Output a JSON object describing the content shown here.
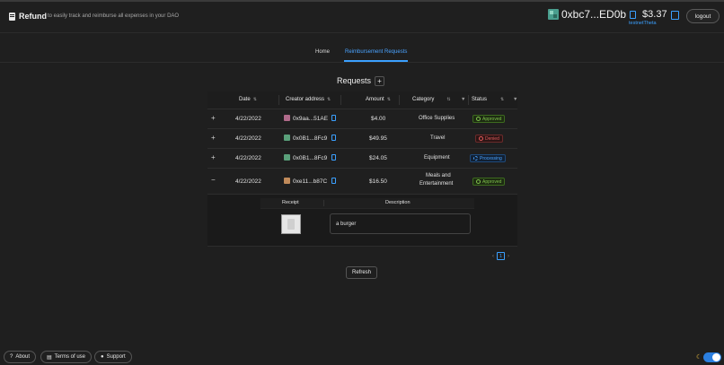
{
  "header": {
    "app_name": "Refund",
    "tagline": "to easily track and reimburse all expenses in your DAO",
    "wallet_address": "0xbc7...ED0b",
    "balance": "$3.37",
    "network": "testnetTheta",
    "logout_label": "logout"
  },
  "nav": {
    "tabs": [
      {
        "label": "Home",
        "active": false
      },
      {
        "label": "Reimbursement Requests",
        "active": true
      }
    ]
  },
  "requests": {
    "title": "Requests",
    "add_label": "+",
    "columns": [
      "Date",
      "Creator address",
      "Amount",
      "Category",
      "Status"
    ],
    "rows": [
      {
        "expand": "+",
        "date": "4/22/2022",
        "creator": "0x9aa...51AE",
        "amount": "$4.00",
        "category": "Office Supplies",
        "status": "Approved",
        "avatar_color": "#b06a8a"
      },
      {
        "expand": "+",
        "date": "4/22/2022",
        "creator": "0x0B1...8Fc9",
        "amount": "$49.95",
        "category": "Travel",
        "status": "Denied",
        "avatar_color": "#5aa07a"
      },
      {
        "expand": "+",
        "date": "4/22/2022",
        "creator": "0x0B1...8Fc9",
        "amount": "$24.05",
        "category": "Equipment",
        "status": "Processing",
        "avatar_color": "#5aa07a"
      },
      {
        "expand": "−",
        "date": "4/22/2022",
        "creator": "0xe11...b87C",
        "amount": "$16.50",
        "category_line1": "Meals and",
        "category_line2": "Entertainment",
        "status": "Approved",
        "avatar_color": "#c08a5a"
      }
    ],
    "expanded": {
      "receipt_header": "Receipt",
      "description_header": "Description",
      "description": "a burger"
    }
  },
  "pagination": {
    "prev": "‹",
    "current": "1",
    "next": "›"
  },
  "refresh_label": "Refresh",
  "footer": {
    "about": "About",
    "terms": "Terms of use",
    "support": "Support"
  },
  "colors": {
    "accent": "#3ba0ff",
    "approved": "#7fc24c",
    "denied": "#e05a5a",
    "processing": "#4aa3ff"
  }
}
